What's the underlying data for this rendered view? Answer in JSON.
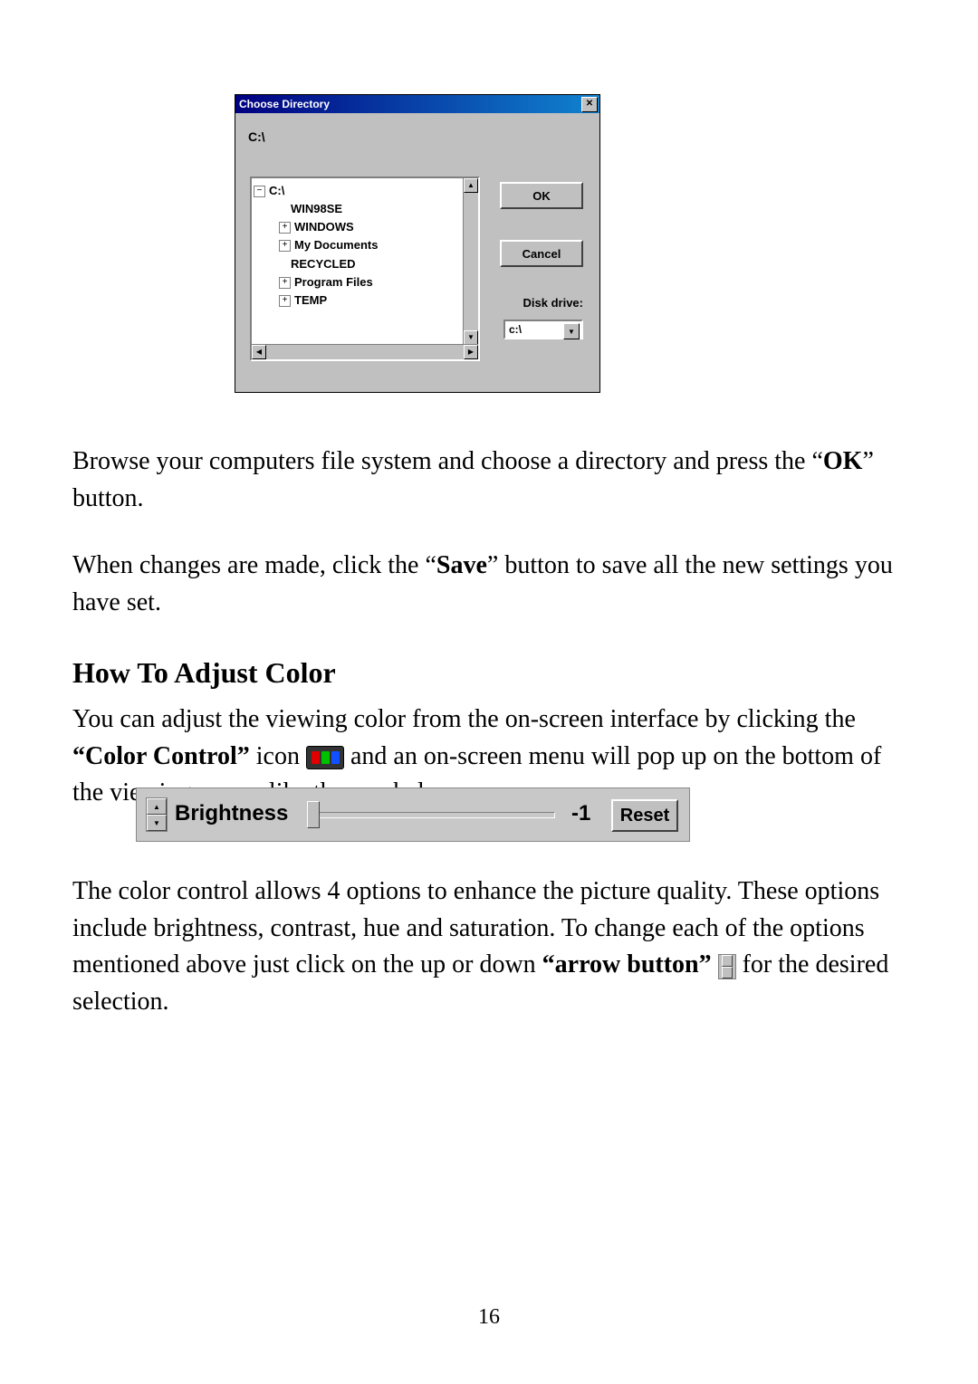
{
  "dialog": {
    "title": "Choose Directory",
    "close_glyph": "✕",
    "current_path": "C:\\",
    "tree": {
      "root": "C:\\",
      "children": {
        "0": "WIN98SE",
        "1": "WINDOWS",
        "2": "My Documents",
        "3": "RECYCLED",
        "4": "Program Files",
        "5": "TEMP"
      }
    },
    "ok_label": "OK",
    "cancel_label": "Cancel",
    "disk_drive_label": "Disk drive:",
    "disk_drive_value": "c:\\"
  },
  "text": {
    "para1_a": "Browse your computers file system and choose a directory and press the “",
    "para1_b": "OK",
    "para1_c": "” button.",
    "para2_a": "When changes are made, click the “",
    "para2_b": "Save",
    "para2_c": "” button to save all the new settings you have set.",
    "heading": "How To Adjust Color",
    "para3_a": "You can adjust the viewing color from the on-screen interface by clicking the ",
    "para3_b": "“Color Control”",
    "para3_c": " icon ",
    "para3_d": " and an on-screen menu will pop up on the bottom of the viewing screen like the one below.",
    "para4_a": "The color control allows 4 options to enhance the picture quality.  These options include brightness, contrast, hue and saturation. To change each of the options mentioned above just click on the up or down ",
    "para4_b": "“arrow button”",
    "para4_c": " ",
    "para4_d": " for the desired selection."
  },
  "brightness_bar": {
    "label": "Brightness",
    "value": "-1",
    "reset_label": "Reset"
  },
  "page_number": "16"
}
